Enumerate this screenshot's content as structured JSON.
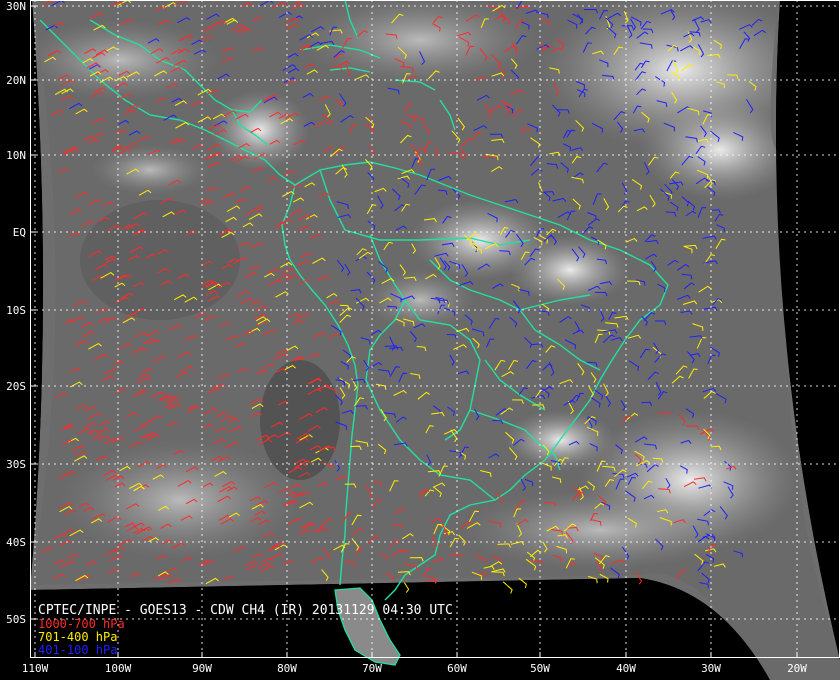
{
  "map": {
    "title": "CPTEC/INPE - GOES13 - CDW CH4 (IR) 20131129 04:30 UTC",
    "legend": [
      {
        "label": "1000-700 hPa",
        "color": "#ff2a2a"
      },
      {
        "label": "701-400 hPa",
        "color": "#ffee00"
      },
      {
        "label": "401-100 hPa",
        "color": "#2020ff"
      }
    ],
    "lat_labels": [
      "30N",
      "20N",
      "10N",
      "EQ",
      "10S",
      "20S",
      "30S",
      "40S",
      "50S"
    ],
    "lon_labels": [
      "110W",
      "100W",
      "90W",
      "80W",
      "70W",
      "60W",
      "50W",
      "40W",
      "30W",
      "20W"
    ],
    "coastline_color": "#22e0a0",
    "grid_color": "#ffffff",
    "background_color": "#000000"
  }
}
